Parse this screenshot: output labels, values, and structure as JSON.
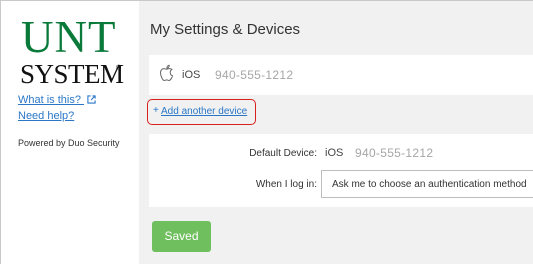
{
  "sidebar": {
    "logo": {
      "line1": "UNT",
      "line2": "SYSTEM",
      "tm": "®"
    },
    "links": {
      "what_is_this": "What is this?",
      "need_help": "Need help?"
    },
    "powered_by": "Powered by Duo Security",
    "colors": {
      "logo_green": "#0a7a3a",
      "link_blue": "#2a77c7"
    }
  },
  "main": {
    "title": "My Settings & Devices",
    "device": {
      "icon": "apple-icon",
      "os": "iOS",
      "number": "940-555-1212"
    },
    "add_device": {
      "plus": "+",
      "label": "Add another device"
    },
    "settings": {
      "default_device_label": "Default Device:",
      "default_device_os": "iOS",
      "default_device_number": "940-555-1212",
      "when_login_label": "When I log in:",
      "when_login_value": "Ask me to choose an authentication method"
    },
    "save_button": "Saved",
    "colors": {
      "save_green": "#6fbf5e",
      "highlight_red": "#d8201d",
      "panel_bg": "#f1f1f1"
    }
  }
}
